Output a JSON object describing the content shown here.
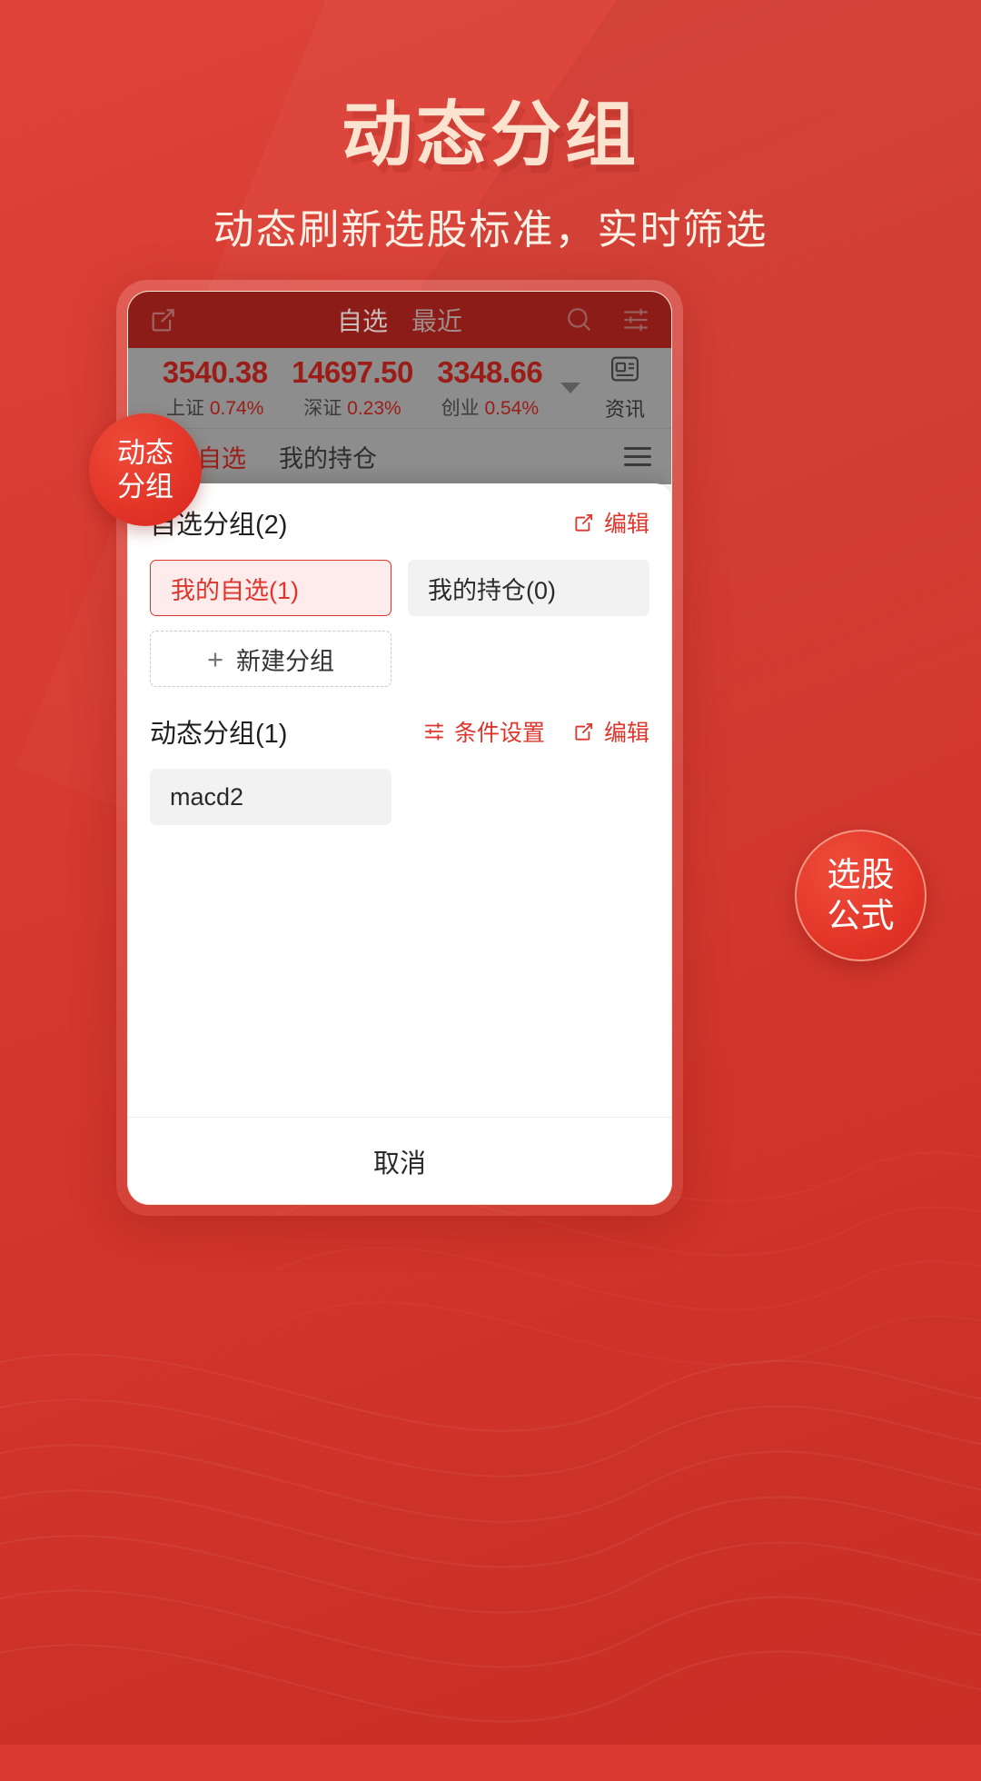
{
  "hero": {
    "title": "动态分组",
    "subtitle": "动态刷新选股标准，实时筛选",
    "title_color": "#fbe3cf",
    "bg_color": "#d8392f"
  },
  "badges": {
    "left": {
      "line1": "动态",
      "line2": "分组"
    },
    "right": {
      "line1": "选股",
      "line2": "公式"
    }
  },
  "app": {
    "header": {
      "edit_icon": "edit-square-icon",
      "tabs": [
        {
          "label": "自选",
          "active": true
        },
        {
          "label": "最近",
          "active": false
        }
      ],
      "search_icon": "search-icon",
      "filter_icon": "sliders-icon"
    },
    "indices": [
      {
        "value": "3540.38",
        "name": "上证",
        "change": "0.74%"
      },
      {
        "value": "14697.50",
        "name": "深证",
        "change": "0.23%"
      },
      {
        "value": "3348.66",
        "name": "创业",
        "change": "0.54%"
      }
    ],
    "index_caret_icon": "caret-down-icon",
    "news": {
      "icon": "news-icon",
      "label": "资讯"
    },
    "sub_tabs": [
      {
        "label": "我的自选",
        "active": true
      },
      {
        "label": "我的持仓",
        "active": false
      }
    ],
    "menu_icon": "hamburger-icon"
  },
  "sheet": {
    "section1": {
      "title": "自选分组(2)",
      "edit": {
        "icon": "edit-pencil-icon",
        "label": "编辑"
      },
      "chips": [
        {
          "label": "我的自选(1)",
          "selected": true
        },
        {
          "label": "我的持仓(0)",
          "selected": false
        }
      ],
      "new_group": {
        "icon": "plus-icon",
        "label": "新建分组"
      }
    },
    "section2": {
      "title": "动态分组(1)",
      "condition": {
        "icon": "sliders-icon",
        "label": "条件设置"
      },
      "edit": {
        "icon": "edit-pencil-icon",
        "label": "编辑"
      },
      "chips": [
        {
          "label": "macd2",
          "selected": false
        }
      ]
    },
    "cancel_label": "取消"
  },
  "colors": {
    "accent_red": "#e0352b",
    "header_dark_red": "#8b1c17",
    "index_gray": "#8d8d8d",
    "index_value_red": "#9b1d17"
  }
}
